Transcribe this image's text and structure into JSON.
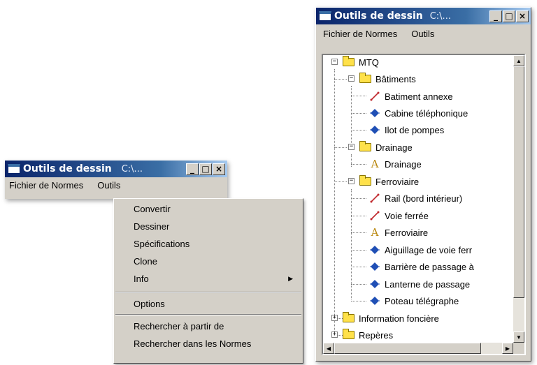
{
  "left_window": {
    "title": "Outils de dessin",
    "path": "C:\\...",
    "buttons": {
      "minimize": "_",
      "maximize": "□",
      "close": "×"
    },
    "menu": [
      "Fichier de Normes",
      "Outils"
    ],
    "outils_menu": {
      "group1": [
        "Convertir",
        "Dessiner",
        "Spécifications",
        "Clone",
        "Info"
      ],
      "group2": [
        "Options"
      ],
      "group3": [
        "Rechercher à partir de",
        "Rechercher dans les Normes"
      ]
    }
  },
  "right_window": {
    "title": "Outils de dessin",
    "path": "C:\\...",
    "buttons": {
      "minimize": "_",
      "maximize": "□",
      "close": "×"
    },
    "menu": [
      "Fichier de Normes",
      "Outils"
    ],
    "tree": {
      "root": "MTQ",
      "batiments": {
        "label": "Bâtiments",
        "items": [
          "Batiment annexe",
          "Cabine téléphonique",
          "Ilot de pompes"
        ]
      },
      "drainage": {
        "label": "Drainage",
        "items": [
          "Drainage"
        ]
      },
      "ferroviaire": {
        "label": "Ferroviaire",
        "items": [
          "Rail (bord intérieur)",
          "Voie ferrée",
          "Ferroviaire",
          "Aiguillage de voie ferr",
          "Barrière de passage à",
          "Lanterne de passage",
          "Poteau télégraphe"
        ]
      },
      "information_fonciere": "Information foncière",
      "reperes": "Repères"
    },
    "icon_names": {
      "line": "line-icon",
      "point": "point-icon",
      "text": "text-icon"
    }
  },
  "colors": {
    "line_icon": "#c0282d",
    "point_icon": "#1f4fb5",
    "text_icon": "#b8860b",
    "folder": "#ffe14a"
  }
}
